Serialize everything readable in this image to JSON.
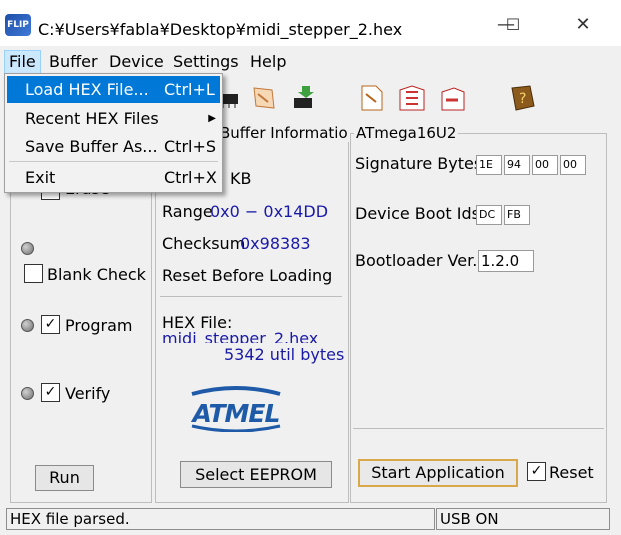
{
  "window": {
    "title": "C:¥Users¥fabla¥Desktop¥midi_stepper_2.hex",
    "app_icon_text": "FLIP",
    "minimize": "—",
    "maximize": "☐",
    "close": "✕"
  },
  "menubar": {
    "items": [
      "File",
      "Buffer",
      "Device",
      "Settings",
      "Help"
    ]
  },
  "file_menu": {
    "items": [
      {
        "label": "Load HEX File...",
        "shortcut": "Ctrl+L"
      },
      {
        "label": "Recent HEX Files",
        "shortcut": "",
        "submenu": "▶"
      },
      {
        "label": "Save Buffer As...",
        "shortcut": "Ctrl+S"
      },
      {
        "label": "Exit",
        "shortcut": "Ctrl+X"
      }
    ]
  },
  "operations": {
    "erase_label": "Erase",
    "blank_check_label": "Blank Check",
    "program_label": "Program",
    "verify_label": "Verify",
    "run_button": "Run",
    "checked": "✓",
    "blank_check_checked": false,
    "program_checked": true,
    "verify_checked": true
  },
  "buffer_info": {
    "title": "Buffer Informatio",
    "size_suffix": "KB",
    "range_label": "Range",
    "range_value": "0x0 − 0x14DD",
    "checksum_label": "Checksum",
    "checksum_value": "0x98383",
    "reset_before_loading": "Reset Before Loading",
    "hex_file_label": "HEX File:",
    "hex_file_value": "midi_stepper_2.hex",
    "bytes": "5342 util bytes",
    "logo_text": "ATMEL",
    "select_eeprom": "Select EEPROM"
  },
  "device": {
    "title": "ATmega16U2",
    "signature_label": "Signature Bytes",
    "signature": [
      "1E",
      "94",
      "00",
      "00"
    ],
    "boot_ids_label": "Device Boot Ids",
    "boot_ids": [
      "DC",
      "FB"
    ],
    "bootloader_label": "Bootloader Ver.",
    "bootloader_value": "1.2.0",
    "start_app_button": "Start Application",
    "reset_label": "Reset",
    "reset_checked": true
  },
  "status": {
    "left": "HEX file parsed.",
    "right": "USB ON"
  },
  "colors": {
    "menu_highlight": "#0078d7",
    "link_blue": "#1a1aa8",
    "atmel_blue": "#1e5aa8"
  }
}
